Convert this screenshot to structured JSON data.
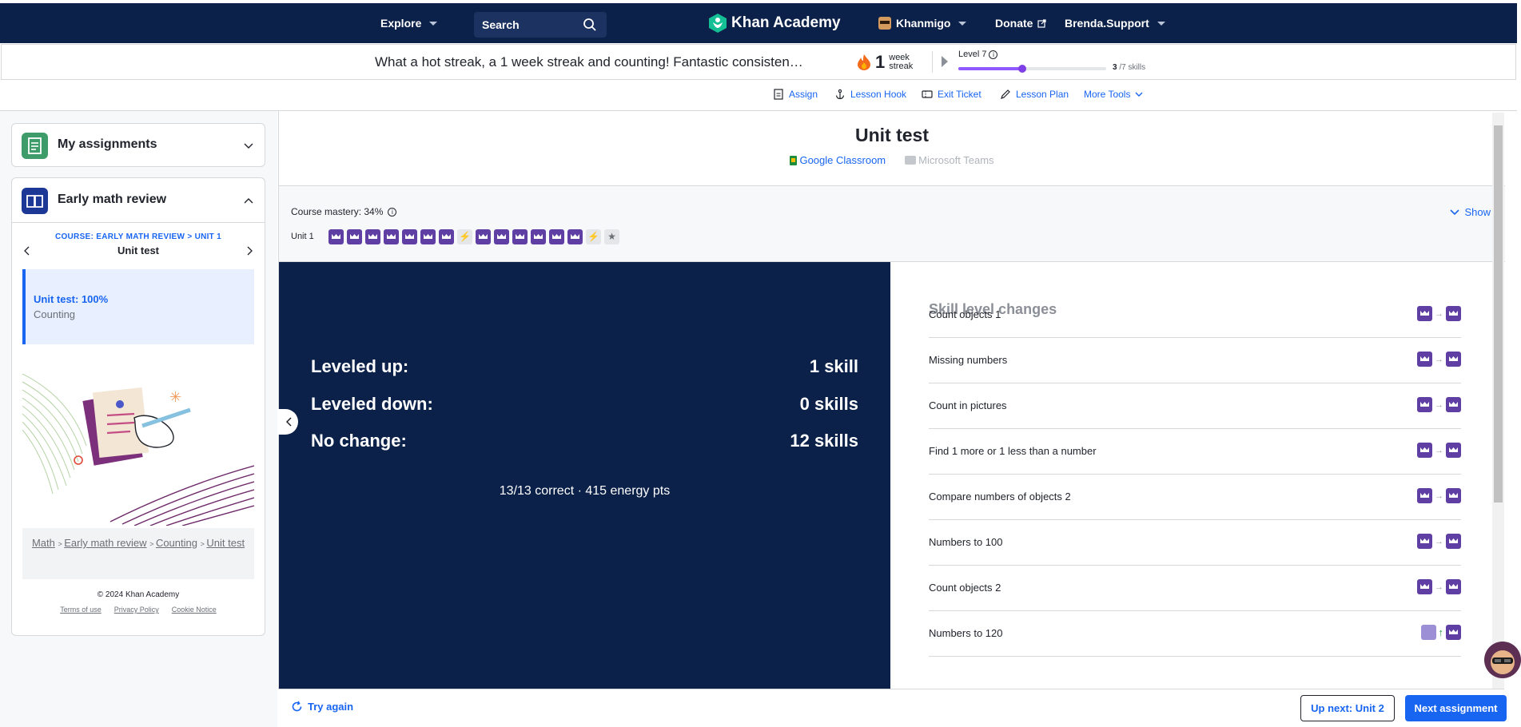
{
  "nav": {
    "explore": "Explore",
    "search_placeholder": "Search",
    "logo": "Khan Academy",
    "khanmigo": "Khanmigo",
    "donate": "Donate",
    "user": "Brenda.Support"
  },
  "streak": {
    "message": "What a hot streak, a 1 week streak and counting! Fantastic consisten…",
    "count": "1",
    "unit_line1": "week",
    "unit_line2": "streak",
    "level": "Level 7",
    "level_progress": 0.43,
    "skills_done": "3",
    "skills_total": "/7 skills"
  },
  "tools": {
    "assign": "Assign",
    "lesson_hook": "Lesson Hook",
    "exit_ticket": "Exit Ticket",
    "lesson_plan": "Lesson Plan",
    "more_tools": "More Tools"
  },
  "sidebar": {
    "my_assignments": "My assignments",
    "course_title": "Early math review",
    "breadcrumb_course": "COURSE: EARLY MATH REVIEW > UNIT 1",
    "current": "Unit test",
    "result_title": "Unit test: 100%",
    "result_sub": "Counting",
    "crumbs": [
      "Math",
      "Early math review",
      "Counting",
      "Unit test"
    ],
    "copyright": "© 2024 Khan Academy",
    "terms": "Terms of use",
    "privacy": "Privacy Policy",
    "cookie": "Cookie Notice"
  },
  "main": {
    "title": "Unit test",
    "google_classroom": "Google Classroom",
    "microsoft_teams": "Microsoft Teams",
    "mastery_label": "Course mastery: 34%",
    "show": "Show",
    "unit_label": "Unit 1",
    "mastery_icons": [
      "crown",
      "crown",
      "crown",
      "crown",
      "crown",
      "crown",
      "crown",
      "bolt",
      "crown",
      "crown",
      "crown",
      "crown",
      "crown",
      "crown",
      "bolt",
      "star"
    ]
  },
  "summary": {
    "leveled_up_label": "Leveled up:",
    "leveled_up_value": "1 skill",
    "leveled_down_label": "Leveled down:",
    "leveled_down_value": "0 skills",
    "no_change_label": "No change:",
    "no_change_value": "12 skills",
    "stats": "13/13 correct · 415 energy pts"
  },
  "skills": {
    "heading": "Skill level changes",
    "rows": [
      {
        "name": "Count objects 1",
        "change": "same"
      },
      {
        "name": "Missing numbers",
        "change": "same"
      },
      {
        "name": "Count in pictures",
        "change": "same"
      },
      {
        "name": "Find 1 more or 1 less than a number",
        "change": "same"
      },
      {
        "name": "Compare numbers of objects 2",
        "change": "same"
      },
      {
        "name": "Numbers to 100",
        "change": "same"
      },
      {
        "name": "Count objects 2",
        "change": "same"
      },
      {
        "name": "Numbers to 120",
        "change": "up"
      }
    ]
  },
  "footer": {
    "try_again": "Try again",
    "up_next": "Up next: Unit 2",
    "next_assignment": "Next assignment"
  },
  "colors": {
    "nav_bg": "#0b2149",
    "accent": "#1865f2",
    "mastery_purple": "#5f3fa3",
    "level_bar": "#9059ff"
  }
}
